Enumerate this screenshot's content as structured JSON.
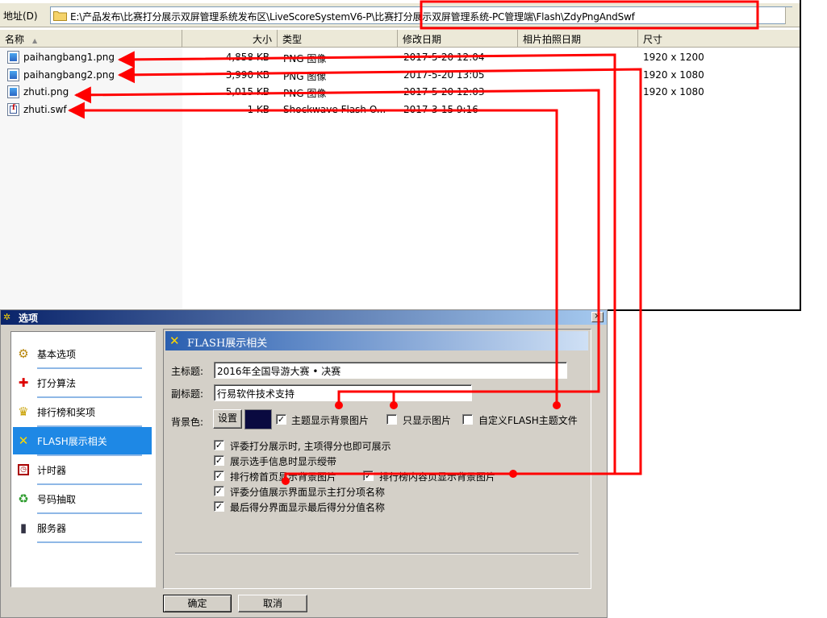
{
  "explorer": {
    "address_label": "地址(D)",
    "address_path": "E:\\产品发布\\比赛打分展示双屏管理系统发布区\\LiveScoreSystemV6-P\\比赛打分展示双屏管理系统-PC管理端\\Flash\\ZdyPngAndSwf",
    "columns": {
      "name": "名称",
      "size": "大小",
      "type": "类型",
      "modified": "修改日期",
      "photo_date": "相片拍照日期",
      "dimensions": "尺寸"
    },
    "files": [
      {
        "name": "paihangbang1.png",
        "size": "4,858 KB",
        "type": "PNG 图像",
        "modified": "2017-5-20 12:04",
        "dimensions": "1920 x 1200",
        "icon": "png-file-icon"
      },
      {
        "name": "paihangbang2.png",
        "size": "3,990 KB",
        "type": "PNG 图像",
        "modified": "2017-5-20 13:05",
        "dimensions": "1920 x 1080",
        "icon": "png-file-icon"
      },
      {
        "name": "zhuti.png",
        "size": "5,015 KB",
        "type": "PNG 图像",
        "modified": "2017-5-20 12:03",
        "dimensions": "1920 x 1080",
        "icon": "png-file-icon"
      },
      {
        "name": "zhuti.swf",
        "size": "1 KB",
        "type": "Shockwave Flash O...",
        "modified": "2017-3-15 9:16",
        "dimensions": "",
        "icon": "swf-file-icon"
      }
    ]
  },
  "dialog": {
    "title": "选项",
    "close_label": "×",
    "nav": [
      {
        "label": "基本选项",
        "icon": "gear-icon",
        "selected": false
      },
      {
        "label": "打分算法",
        "icon": "plus-icon",
        "selected": false
      },
      {
        "label": "排行榜和奖项",
        "icon": "trophy-icon",
        "selected": false
      },
      {
        "label": "FLASH展示相关",
        "icon": "flash-tools-icon",
        "selected": true
      },
      {
        "label": "计时器",
        "icon": "timer-icon",
        "selected": false
      },
      {
        "label": "号码抽取",
        "icon": "recycle-icon",
        "selected": false
      },
      {
        "label": "服务器",
        "icon": "server-icon",
        "selected": false
      }
    ],
    "panel": {
      "header": "FLASH展示相关",
      "main_title_label": "主标题:",
      "main_title_value": "2016年全国导游大赛 • 决赛",
      "subtitle_label": "副标题:",
      "subtitle_value": "行易软件技术支持",
      "bgcolor_label": "背景色:",
      "set_button": "设置",
      "bgcolor_value": "#0a0a40",
      "check_mark": "✓",
      "inline_checks": [
        {
          "label": "主题显示背景图片",
          "checked": true
        },
        {
          "label": "只显示图片",
          "checked": false
        },
        {
          "label": "自定义FLASH主题文件",
          "checked": false
        }
      ],
      "checks": [
        {
          "label": "评委打分展示时, 主项得分也即可展示",
          "checked": true
        },
        {
          "label": "展示选手信息时显示绶带",
          "checked": true
        },
        {
          "label": "排行榜首页显示背景图片",
          "checked": true
        },
        {
          "label": "排行榜内容页显示背景图片",
          "checked": true
        },
        {
          "label": "评委分值展示界面显示主打分项名称",
          "checked": true
        },
        {
          "label": "最后得分界面显示最后得分分值名称",
          "checked": true
        }
      ]
    },
    "ok_button": "确定",
    "cancel_button": "取消"
  },
  "annotation_color": "#ff0000"
}
